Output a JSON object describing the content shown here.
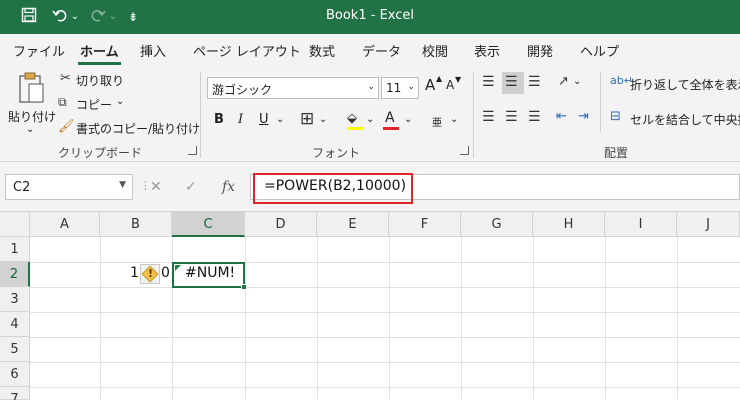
{
  "window": {
    "title": "Book1  -  Excel"
  },
  "quick_access": {
    "save_icon": "save-icon",
    "undo_icon": "undo-icon",
    "redo_icon": "redo-icon",
    "customize_icon": "customize-icon",
    "undo_dd": "⌄",
    "redo_dd": "⌄",
    "customize_glyph": "⇟"
  },
  "tabs": [
    "ファイル",
    "ホーム",
    "挿入",
    "ページ レイアウト",
    "数式",
    "データ",
    "校閲",
    "表示",
    "開発",
    "ヘルプ"
  ],
  "active_tab": "ホーム",
  "ribbon": {
    "clipboard": {
      "paste": "貼り付け",
      "paste_dd": "⌄",
      "cut": "切り取り",
      "copy": "コピー",
      "copy_dd": "⌄",
      "format_painter": "書式のコピー/貼り付け",
      "label": "クリップボード"
    },
    "font": {
      "name": "游ゴシック",
      "size": "11",
      "grow": "A",
      "shrink": "A",
      "bold": "B",
      "italic": "I",
      "underline": "U",
      "underline_dd": "⌄",
      "borders_dd": "⌄",
      "fill_dd": "⌄",
      "fontcolor": "A",
      "fontcolor_dd": "⌄",
      "phonetic": "亜",
      "phonetic_dd": "⌄",
      "label": "フォント"
    },
    "alignment": {
      "wrap": "折り返して全体を表示す",
      "merge": "セルを結合して中央揃",
      "label": "配置"
    }
  },
  "formula_bar": {
    "name_box": "C2",
    "cancel": "✕",
    "enter": "✓",
    "fx": "fx",
    "formula": "=POWER(B2,10000)"
  },
  "grid": {
    "columns": [
      "A",
      "B",
      "C",
      "D",
      "E",
      "F",
      "G",
      "H",
      "I",
      "J"
    ],
    "rows": [
      "1",
      "2",
      "3",
      "4",
      "5",
      "6",
      "7"
    ],
    "selected_cell": "C2",
    "cells": {
      "B2_left": "1",
      "B2_right": "0",
      "C2": "#NUM!"
    },
    "warning_mark": "!"
  },
  "colors": {
    "accent": "#217346",
    "highlight": "#e0242a"
  }
}
